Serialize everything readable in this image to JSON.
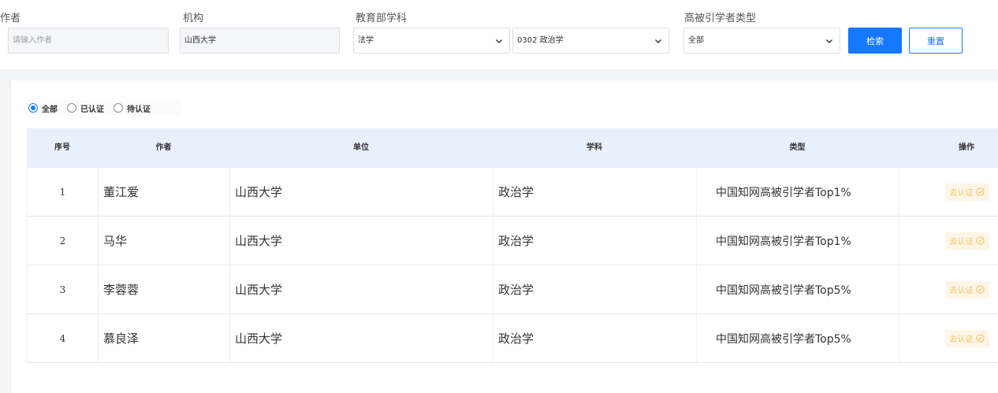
{
  "filters": {
    "author": {
      "label": "作者",
      "placeholder": "请输入作者",
      "value": ""
    },
    "org": {
      "label": "机构",
      "value": "山西大学"
    },
    "discipline": {
      "label": "教育部学科",
      "primary": "法学",
      "secondary": "0302 政治学"
    },
    "scholar_type": {
      "label": "高被引学者类型",
      "value": "全部"
    },
    "search_button": "检索",
    "reset_button": "重置"
  },
  "status_filter": {
    "options": [
      {
        "label": "全部",
        "selected": true
      },
      {
        "label": "已认证",
        "selected": false
      },
      {
        "label": "待认证",
        "selected": false
      }
    ]
  },
  "table": {
    "headers": [
      "序号",
      "作者",
      "单位",
      "学科",
      "类型",
      "操作"
    ],
    "rows": [
      {
        "index": "1",
        "author": "董江爱",
        "unit": "山西大学",
        "subject": "政治学",
        "type": "中国知网高被引学者Top1%",
        "action": "去认证"
      },
      {
        "index": "2",
        "author": "马华",
        "unit": "山西大学",
        "subject": "政治学",
        "type": "中国知网高被引学者Top1%",
        "action": "去认证"
      },
      {
        "index": "3",
        "author": "李蓉蓉",
        "unit": "山西大学",
        "subject": "政治学",
        "type": "中国知网高被引学者Top5%",
        "action": "去认证"
      },
      {
        "index": "4",
        "author": "慕良泽",
        "unit": "山西大学",
        "subject": "政治学",
        "type": "中国知网高被引学者Top5%",
        "action": "去认证"
      }
    ]
  },
  "colors": {
    "primary": "#1677ff",
    "header_bg": "#e8f0fc",
    "verify_text": "#f4c15f",
    "verify_bg": "#fdf6e8"
  },
  "icons": {
    "dropdown": "chevron-down-icon",
    "verify": "check-circle-icon"
  }
}
